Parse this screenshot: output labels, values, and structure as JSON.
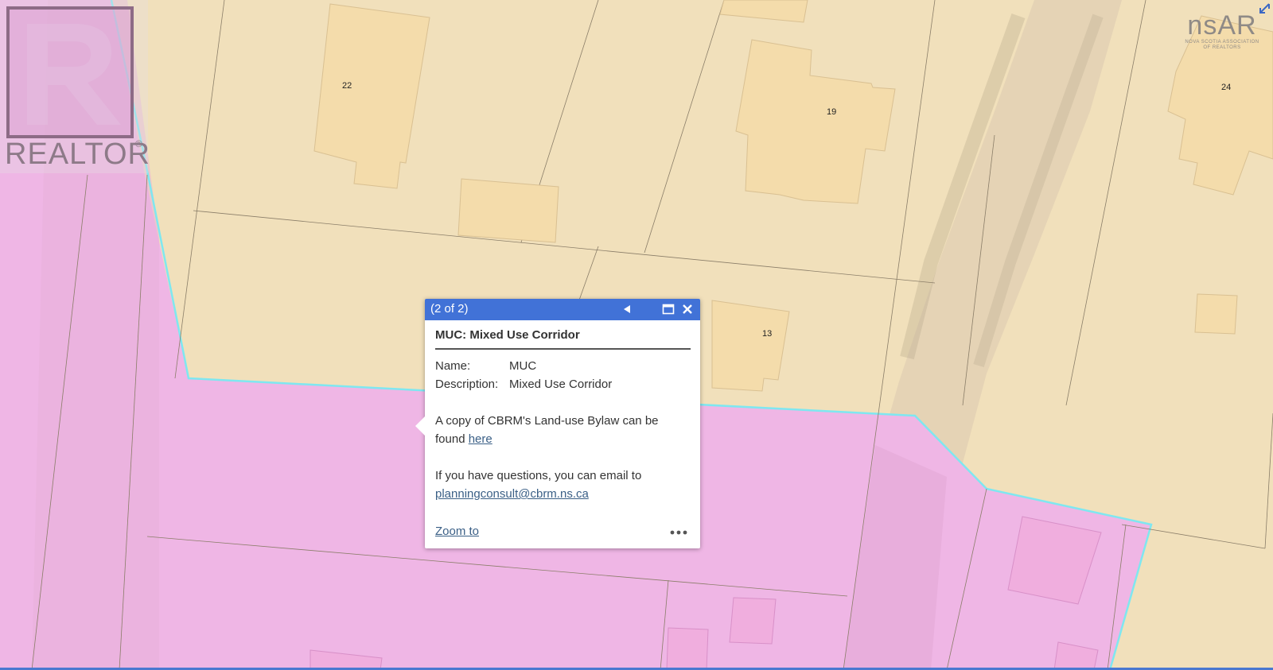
{
  "map": {
    "lot_numbers": [
      "22",
      "19",
      "24",
      "13"
    ],
    "zone_colors": {
      "residential": "#f1e0bb",
      "mixed_use": "#efb6e5",
      "boundary": "#7fe7f0",
      "building": "#f4dcab"
    }
  },
  "logos": {
    "realtor": "REALTOR",
    "realtor_mark": "®",
    "nsar": "nsAR",
    "nsar_sub_1": "NOVA SCOTIA ASSOCIATION",
    "nsar_sub_2": "OF REALTORS"
  },
  "popup": {
    "counter": "(2 of 2)",
    "title": "MUC: Mixed Use Corridor",
    "attributes": [
      {
        "key": "Name:",
        "value": "MUC"
      },
      {
        "key": "Description:",
        "value": "Mixed Use Corridor"
      }
    ],
    "bylaw_text": "A copy of CBRM's Land-use Bylaw can be found ",
    "bylaw_link": "here",
    "questions_text": "If you have questions, you can email to",
    "email_link": "planningconsult@cbrm.ns.ca",
    "zoom_link": "Zoom to",
    "header_color": "#4172d7"
  },
  "icons": {
    "prev": "triangle-left-icon",
    "maximize": "maximize-icon",
    "close": "close-icon",
    "more": "ellipsis-icon",
    "expand": "expand-arrow-icon"
  }
}
